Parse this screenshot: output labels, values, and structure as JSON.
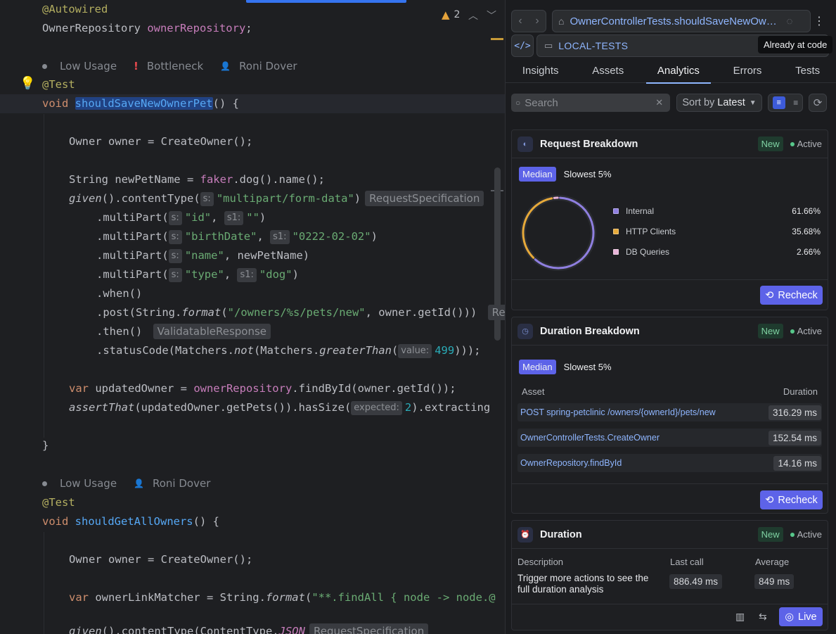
{
  "editor": {
    "warnings_count": "2",
    "lines": {
      "autowired": "@Autowired",
      "repo_type": "OwnerRepository ",
      "repo_field": "ownerRepository",
      "test1": "@Test",
      "void": "void ",
      "method1": "shouldSaveNewOwnerPet",
      "method1_tail": "() {",
      "l_owner_a": "Owner owner = CreateOwner();",
      "l_string": "String newPetName = ",
      "l_faker": "faker",
      "l_faker_tail": ".dog().name();",
      "given": "given",
      "content_type": "().contentType(",
      "hint_s": "s:",
      "hint_s1": "s1:",
      "str_multipart": "\"multipart/form-data\"",
      "close_paren": ")",
      "req_spec": "RequestSpecification",
      "multipart": ".multiPart(",
      "str_id": "\"id\"",
      "comma": ", ",
      "str_empty": "\"\"",
      "str_birth": "\"birthDate\"",
      "str_date": "\"0222-02-02\"",
      "str_name": "\"name\"",
      "name_var": ", newPetName)",
      "str_type": "\"type\"",
      "str_dog": "\"dog\"",
      "when": ".when()",
      "post_a": ".post(String.",
      "format": "format",
      "post_b": "(",
      "str_owners": "\"/owners/%s/pets/new\"",
      "post_c": ", owner.getId())) ",
      "post_hint": "Re",
      "then": ".then() ",
      "validatable": "ValidatableResponse",
      "status_a": ".statusCode(Matchers.",
      "not": "not",
      "status_b": "(Matchers.",
      "greater": "greaterThan",
      "status_c": "(",
      "hint_value": "value:",
      "num_499": "499",
      "status_d": ")));",
      "var": "var ",
      "updated_a": "updatedOwner = ",
      "updated_b": ".findById(owner.getId());",
      "assert": "assertThat",
      "assert_a": "(updatedOwner.getPets()).hasSize(",
      "hint_expected": "expected:",
      "num_2": "2",
      "assert_b": ").extracting",
      "brace_close": "}",
      "test2": "@Test",
      "method2": "shouldGetAllOwners",
      "method2_tail": "() {",
      "l_owner_b": "Owner owner = CreateOwner();",
      "link_a": "ownerLinkMatcher = String.",
      "link_b": "(",
      "str_findall": "\"**.findAll { node -> node.@",
      "given_b": "().contentType(ContentType.",
      "json": "JSON",
      "req_spec_b": "RequestSpecification"
    },
    "meta1": {
      "usage": "Low Usage",
      "bottleneck": "Bottleneck",
      "author": "Roni Dover"
    },
    "meta2": {
      "usage": "Low Usage",
      "author": "Roni Dover"
    }
  },
  "panel": {
    "url": "OwnerControllerTests.shouldSaveNewOwnerPet",
    "env": "LOCAL-TESTS",
    "tooltip": "Already at code",
    "tabs": [
      "Insights",
      "Assets",
      "Analytics",
      "Errors",
      "Tests"
    ],
    "active_tab": "Analytics",
    "search_placeholder": "Search",
    "sort_label": "Sort by",
    "sort_value": "Latest",
    "cards": {
      "request": {
        "title": "Request Breakdown",
        "badge": "New",
        "status": "Active",
        "pills": [
          "Median",
          "Slowest 5%"
        ],
        "legend": [
          {
            "name": "Internal",
            "value": "61.66%",
            "color": "#8f7fe0"
          },
          {
            "name": "HTTP Clients",
            "value": "35.68%",
            "color": "#e6a93a"
          },
          {
            "name": "DB Queries",
            "value": "2.66%",
            "color": "#e8b4d8"
          }
        ],
        "button": "Recheck"
      },
      "duration_breakdown": {
        "title": "Duration Breakdown",
        "badge": "New",
        "status": "Active",
        "pills": [
          "Median",
          "Slowest 5%"
        ],
        "col_asset": "Asset",
        "col_duration": "Duration",
        "rows": [
          {
            "asset": "POST spring-petclinic /owners/{ownerId}/pets/new",
            "duration": "316.29 ms"
          },
          {
            "asset": "OwnerControllerTests.CreateOwner",
            "duration": "152.54 ms"
          },
          {
            "asset": "OwnerRepository.findById",
            "duration": "14.16 ms"
          }
        ],
        "button": "Recheck"
      },
      "duration": {
        "title": "Duration",
        "badge": "New",
        "status": "Active",
        "col_description": "Description",
        "col_last": "Last call",
        "col_average": "Average",
        "description": "Trigger more actions to see the full duration analysis",
        "last_call": "886.49 ms",
        "average": "849 ms",
        "button": "Live"
      }
    }
  },
  "colors": {
    "accent": "#5d63e8",
    "link": "#8fb6ff",
    "active_green": "#57c78a"
  }
}
